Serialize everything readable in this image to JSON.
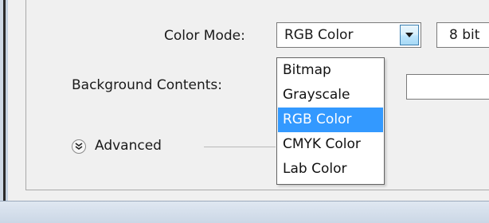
{
  "form": {
    "color_mode_label": "Color Mode:",
    "color_mode_value": "RGB Color",
    "bit_depth_value": "8 bit",
    "background_label": "Background Contents:",
    "advanced_label": "Advanced"
  },
  "dropdown": {
    "options": [
      "Bitmap",
      "Grayscale",
      "RGB Color",
      "CMYK Color",
      "Lab Color"
    ],
    "selected": "RGB Color"
  },
  "colors": {
    "highlight": "#3399ff",
    "panel_bg": "#f0f0f0"
  },
  "icons": {
    "combo_arrow": "chevron-down-icon",
    "advanced_toggle": "double-chevron-down-icon"
  }
}
